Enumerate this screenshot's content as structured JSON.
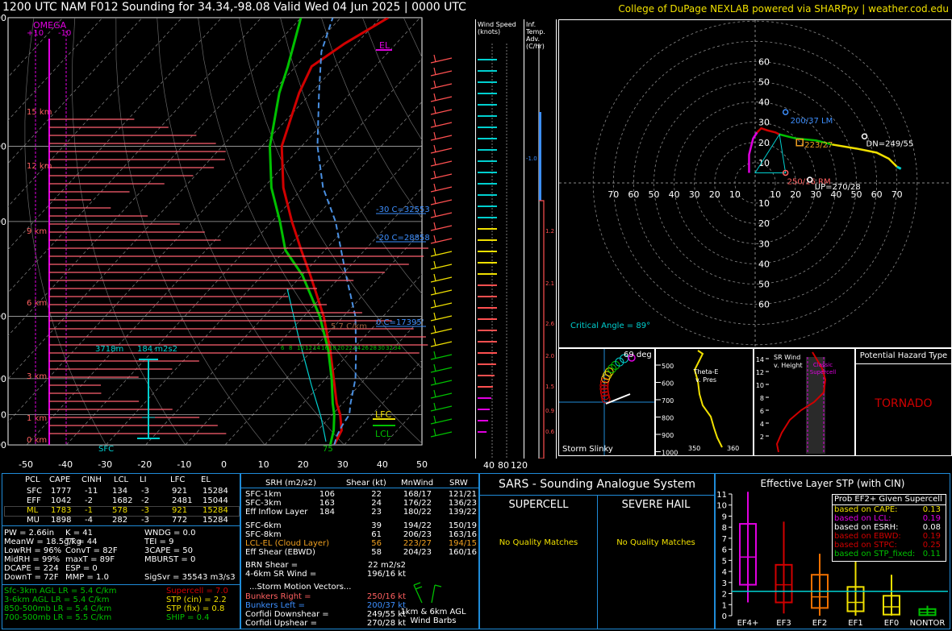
{
  "header": {
    "title": "1200 UTC NAM F012 Sounding for 34.34,-98.08 Valid  Wed 04 Jun 2025 | 0000 UTC",
    "credit": "College of DuPage NEXLAB powered via SHARPpy | weather.cod.edu"
  },
  "skewt": {
    "omega_label": "OMEGA",
    "omega_ticks": [
      "+10",
      "-10"
    ],
    "pressure_labels": [
      "100",
      "200",
      "300",
      "500",
      "700",
      "850",
      "1000"
    ],
    "temp_labels": [
      "-50",
      "-40",
      "-30",
      "-20",
      "-10",
      "0",
      "10",
      "20",
      "30",
      "40",
      "50"
    ],
    "height_labels": [
      "15 km",
      "12 km",
      "9 km",
      "6 km",
      "3 km",
      "1 km",
      "0 km"
    ],
    "el_label": "EL",
    "lfc_label": "LFC",
    "lcl_label": "LCL",
    "sfc_label": "SFC",
    "sfc_temp": "75",
    "iso_m30": "-30 C=32553",
    "iso_m20": "-20 C=28858",
    "iso_0": "0 C=17395'",
    "lapse_label": "5.7 C/km",
    "eff_inflow_top": "3718m",
    "eff_srh": "184 m2s2",
    "thetae_ticks": [
      "6",
      "8",
      "10",
      "12",
      "14",
      "16",
      "18",
      "20",
      "22",
      "24",
      "26",
      "28",
      "30",
      "32",
      "34"
    ],
    "chart_data": {
      "type": "line",
      "title": "",
      "xlabel": "",
      "ylabel": "",
      "xlim": [
        -50,
        50
      ],
      "ylim_pressure": [
        1000,
        100
      ],
      "series": [
        {
          "key": "temperature",
          "color": "#d00000",
          "points": [
            [
              1000,
              27.5
            ],
            [
              925,
              26
            ],
            [
              850,
              22
            ],
            [
              800,
              18.5
            ],
            [
              700,
              12
            ],
            [
              600,
              4.5
            ],
            [
              500,
              -5
            ],
            [
              400,
              -18
            ],
            [
              350,
              -26
            ],
            [
              300,
              -35
            ],
            [
              250,
              -45
            ],
            [
              200,
              -55
            ],
            [
              150,
              -63
            ],
            [
              130,
              -66
            ],
            [
              115,
              -63
            ],
            [
              100,
              -58
            ]
          ]
        },
        {
          "key": "dewpoint",
          "color": "#00c000",
          "points": [
            [
              1000,
              26.5
            ],
            [
              925,
              24
            ],
            [
              850,
              20.5
            ],
            [
              800,
              17.5
            ],
            [
              700,
              11.5
            ],
            [
              600,
              4
            ],
            [
              500,
              -6
            ],
            [
              400,
              -20
            ],
            [
              350,
              -30
            ],
            [
              300,
              -38
            ],
            [
              250,
              -48
            ],
            [
              200,
              -58
            ],
            [
              150,
              -68
            ],
            [
              130,
              -72
            ],
            [
              100,
              -80
            ]
          ]
        },
        {
          "key": "parcel",
          "color": "#4a90e2",
          "points": [
            [
              1000,
              27.5
            ],
            [
              950,
              26
            ],
            [
              900,
              25
            ],
            [
              850,
              24.3
            ],
            [
              800,
              22
            ],
            [
              700,
              17.5
            ],
            [
              600,
              11
            ],
            [
              500,
              3
            ],
            [
              400,
              -9
            ],
            [
              300,
              -24
            ],
            [
              250,
              -35
            ],
            [
              200,
              -46
            ],
            [
              150,
              -58
            ],
            [
              120,
              -67
            ],
            [
              100,
              -72
            ]
          ]
        }
      ]
    }
  },
  "wind_speed": {
    "title": "Wind Speed (knots)",
    "ticks": [
      "40",
      "80",
      "120"
    ]
  },
  "temp_adv": {
    "title": "Inf. Temp. Adv.(C/hr)",
    "values": [
      "-1.0",
      "1.2",
      "2.1",
      "2.6",
      "2.0",
      "1.5",
      "0.9",
      "0.6"
    ]
  },
  "hodograph": {
    "ring_labels": [
      "10",
      "20",
      "30",
      "40",
      "50",
      "60"
    ],
    "x_labels": [
      "70",
      "60",
      "50",
      "40",
      "30",
      "20",
      "10",
      "10",
      "20",
      "30",
      "40",
      "50",
      "60",
      "70"
    ],
    "lm_label": "200/37 LM",
    "mean_label": "223/27",
    "dn_label": "DN=249/55",
    "rm_label": "250/16 RM",
    "up_label": "UP=270/28",
    "critical_angle": "Critical Angle = 89°"
  },
  "slinky": {
    "angle_label": "69 deg",
    "title": "Storm Slinky"
  },
  "thetae": {
    "label": "Theta-E v. Pres",
    "pres_ticks": [
      "500",
      "600",
      "700",
      "800",
      "900",
      "1000"
    ],
    "x_ticks": [
      "350",
      "360"
    ]
  },
  "srwind": {
    "label": "SR Wind v. Height",
    "sub": "Classic Supercell",
    "h_ticks": [
      "14",
      "12",
      "10",
      "8",
      "6",
      "4",
      "2"
    ]
  },
  "hazard": {
    "title": "Potential Hazard Type",
    "value": "TORNADO",
    "color": "#d00000"
  },
  "parcel_table": {
    "headers": [
      "PCL",
      "CAPE",
      "CINH",
      "LCL",
      "LI",
      "LFC",
      "EL"
    ],
    "rows": [
      [
        "SFC",
        "1777",
        "-11",
        "134",
        "-3",
        "921",
        "15284"
      ],
      [
        "EFF",
        "1042",
        "-2",
        "1682",
        "-2",
        "2481",
        "15044"
      ],
      [
        "ML",
        "1783",
        "-1",
        "578",
        "-3",
        "921",
        "15284"
      ],
      [
        "MU",
        "1898",
        "-4",
        "282",
        "-3",
        "772",
        "15284"
      ]
    ],
    "highlight_row": 2,
    "highlight_color": "#f0e000"
  },
  "thermo_indices": {
    "col1": [
      "PW = 2.66in",
      "MeanW = 18.5g/kg",
      "LowRH = 96%",
      "MidRH = 99%",
      "DCAPE = 224",
      "DownT = 72F"
    ],
    "col2": [
      "K = 41",
      "TT = 44",
      "ConvT = 82F",
      "maxT = 89F",
      "ESP = 0",
      "MMP = 1.0"
    ],
    "col3": [
      "WNDG = 0.0",
      "TEI = 9",
      "3CAPE = 50",
      "MBURST = 0",
      "",
      "SigSvr = 35543 m3/s3"
    ]
  },
  "lapse_rates": [
    "Sfc-3km AGL LR = 5.4 C/km",
    "3-6km AGL LR = 5.4 C/km",
    "850-500mb LR = 5.4 C/km",
    "700-500mb LR = 5.5 C/km"
  ],
  "composite_params": [
    {
      "label": "Supercell = 7.0",
      "color": "#d00000"
    },
    {
      "label": "STP (cin) = 2.2",
      "color": "#f0e000"
    },
    {
      "label": "STP (fix) = 0.8",
      "color": "#f0e000"
    },
    {
      "label": "SHIP = 0.4",
      "color": "#00c000"
    }
  ],
  "kinematic_table": {
    "headers": [
      "SRH (m2/s2)",
      "Shear (kt)",
      "MnWind",
      "SRW"
    ],
    "rows": [
      {
        "label": "SFC-1km",
        "srh": "106",
        "shear": "22",
        "mn": "168/17",
        "srw": "121/21",
        "color": "#ffffff"
      },
      {
        "label": "SFC-3km",
        "srh": "163",
        "shear": "24",
        "mn": "176/22",
        "srw": "136/23",
        "color": "#ffffff"
      },
      {
        "label": "Eff Inflow Layer",
        "srh": "184",
        "shear": "23",
        "mn": "180/22",
        "srw": "139/22",
        "color": "#ffffff"
      },
      {
        "label": "SFC-6km",
        "srh": "39",
        "shear": "194/22",
        "mn": "150/19",
        "srw": "",
        "color": "#ffffff"
      },
      {
        "label": "SFC-8km",
        "srh": "61",
        "shear": "206/23",
        "mn": "163/16",
        "srw": "",
        "color": "#ffffff"
      },
      {
        "label": "LCL-EL (Cloud Layer)",
        "srh": "56",
        "shear": "223/27",
        "mn": "194/15",
        "srw": "",
        "color": "#f0a020"
      },
      {
        "label": "Eff Shear (EBWD)",
        "srh": "58",
        "shear": "204/23",
        "mn": "160/16",
        "srw": "",
        "color": "#ffffff"
      }
    ],
    "brn_shear": "BRN Shear =",
    "brn_value": "22 m2/s2",
    "sr_wind_label": "4-6km SR Wind =",
    "sr_wind_value": "196/16 kt",
    "storm_motion_title": "...Storm Motion Vectors...",
    "motions": [
      {
        "label": "Bunkers Right =",
        "value": "250/16 kt",
        "color": "#ff6060"
      },
      {
        "label": "Bunkers Left =",
        "value": "200/37 kt",
        "color": "#3d8fff"
      },
      {
        "label": "Corfidi Downshear =",
        "value": "249/55 kt",
        "color": "#ffffff"
      },
      {
        "label": "Corfidi Upshear =",
        "value": "270/28 kt",
        "color": "#ffffff"
      }
    ],
    "barb_caption": "1km & 6km AGL Wind Barbs"
  },
  "sars": {
    "title": "SARS - Sounding Analogue System",
    "supercell": "SUPERCELL",
    "hail": "SEVERE HAIL",
    "supercell_msg": "No Quality Matches",
    "hail_msg": "No Quality Matches"
  },
  "stp_panel": {
    "title": "Effective Layer STP (with CIN)",
    "y_ticks": [
      "11",
      "10",
      "9",
      "8",
      "7",
      "6",
      "5",
      "4",
      "3",
      "2",
      "1",
      "0"
    ],
    "categories": [
      "EF4+",
      "EF3",
      "EF2",
      "EF1",
      "EF0",
      "NONTOR"
    ],
    "current_stp": 2.2,
    "legend_title": "Prob EF2+ Given Supercell",
    "legend": [
      {
        "label": "based on CAPE:",
        "value": "0.13",
        "color": "#f0e000"
      },
      {
        "label": "based on LCL:",
        "value": "0.19",
        "color": "#e000e0"
      },
      {
        "label": "based on ESRH:",
        "value": "0.08",
        "color": "#ffffff"
      },
      {
        "label": "based on EBWD:",
        "value": "0.19",
        "color": "#d00000"
      },
      {
        "label": "based on STPC:",
        "value": "0.25",
        "color": "#d00000"
      },
      {
        "label": "based on STP_fixed:",
        "value": "0.11",
        "color": "#00c000"
      }
    ],
    "chart_data": {
      "type": "box",
      "categories": [
        "EF4+",
        "EF3",
        "EF2",
        "EF1",
        "EF0",
        "NONTOR"
      ],
      "series": [
        {
          "name": "EF4+",
          "color": "#e000e0",
          "whisker": [
            1.2,
            11.2
          ],
          "box": [
            2.8,
            8.3
          ],
          "median": 5.3
        },
        {
          "name": "EF3",
          "color": "#d00000",
          "whisker": [
            0.2,
            8.5
          ],
          "box": [
            1.2,
            4.6
          ],
          "median": 2.8
        },
        {
          "name": "EF2",
          "color": "#f07000",
          "whisker": [
            0.0,
            5.6
          ],
          "box": [
            0.7,
            3.7
          ],
          "median": 1.7
        },
        {
          "name": "EF1",
          "color": "#f0e000",
          "whisker": [
            0.0,
            5.0
          ],
          "box": [
            0.4,
            2.6
          ],
          "median": 1.2
        },
        {
          "name": "EF0",
          "color": "#f0e000",
          "whisker": [
            0.0,
            3.7
          ],
          "box": [
            0.1,
            1.8
          ],
          "median": 0.8
        },
        {
          "name": "NONTOR",
          "color": "#00c000",
          "whisker": [
            0.0,
            0.9
          ],
          "box": [
            0.05,
            0.6
          ],
          "median": 0.3
        }
      ],
      "ylim": [
        0,
        11
      ]
    }
  }
}
